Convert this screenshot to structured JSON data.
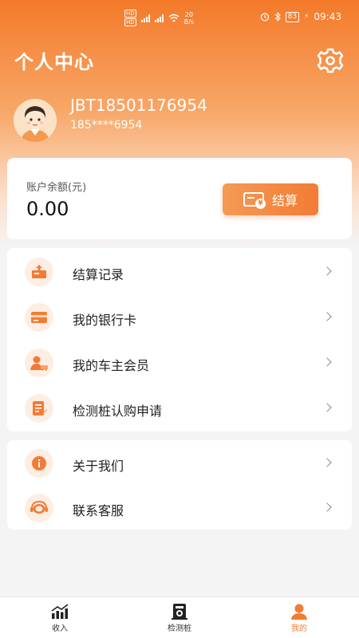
{
  "status_bar": {
    "hd1": "HD",
    "hd2": "HD",
    "net_speed": "20",
    "net_unit": "B/s",
    "battery": "83",
    "time": "09:43"
  },
  "header": {
    "title": "个人中心",
    "settings_icon": "gear-icon"
  },
  "user": {
    "name": "JBT18501176954",
    "phone": "185****6954"
  },
  "balance": {
    "label": "账户余额(元)",
    "value": "0.00",
    "settle_label": "结算"
  },
  "menu_group_1": [
    {
      "label": "结算记录",
      "icon": "settlement-record-icon"
    },
    {
      "label": "我的银行卡",
      "icon": "bank-card-icon"
    },
    {
      "label": "我的车主会员",
      "icon": "car-owner-member-icon"
    },
    {
      "label": "检测桩认购申请",
      "icon": "application-form-icon"
    }
  ],
  "menu_group_2": [
    {
      "label": "关于我们",
      "icon": "info-icon"
    },
    {
      "label": "联系客服",
      "icon": "customer-service-icon"
    }
  ],
  "tabbar": {
    "tabs": [
      {
        "label": "收入",
        "icon": "income-chart-icon"
      },
      {
        "label": "检测桩",
        "icon": "charging-pile-icon"
      },
      {
        "label": "我的",
        "icon": "person-icon"
      }
    ],
    "active": "我的",
    "accent": "#f27c35"
  },
  "colors": {
    "brand": "#f47a2a",
    "icon_bg": "#fdeee3"
  }
}
